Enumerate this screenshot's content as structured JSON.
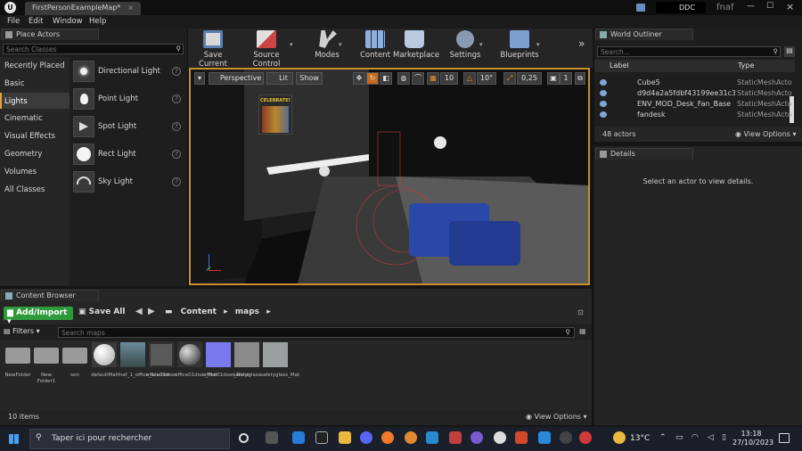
{
  "window": {
    "tab_title": "FirstPersonExampleMap*",
    "ddc_label": "DDC",
    "project_name": "fnaf"
  },
  "menu": [
    "File",
    "Edit",
    "Window",
    "Help"
  ],
  "place_actors": {
    "title": "Place Actors",
    "search_placeholder": "Search Classes",
    "categories": [
      "Recently Placed",
      "Basic",
      "Lights",
      "Cinematic",
      "Visual Effects",
      "Geometry",
      "Volumes",
      "All Classes"
    ],
    "selected_category": "Lights",
    "items": [
      "Directional Light",
      "Point Light",
      "Spot Light",
      "Rect Light",
      "Sky Light"
    ]
  },
  "toolbar": {
    "buttons": [
      "Save Current",
      "Source Control",
      "Modes",
      "Content",
      "Marketplace",
      "Settings",
      "Blueprints"
    ]
  },
  "viewport": {
    "perspective": "Perspective",
    "lit": "Lit",
    "show": "Show",
    "grid_snap": "10",
    "rotation_snap": "10°",
    "scale_snap": "0,25",
    "camera_speed": "1",
    "poster_text": "CELEBRATE!"
  },
  "world_outliner": {
    "title": "World Outliner",
    "search_placeholder": "Search...",
    "col_label": "Label",
    "col_type": "Type",
    "rows": [
      {
        "label": "Cube5",
        "type": "StaticMeshActor"
      },
      {
        "label": "d9d4a2a5fdbf43199ee31c3d0b",
        "type": "StaticMeshActor"
      },
      {
        "label": "ENV_MOD_Desk_Fan_Base",
        "type": "StaticMeshActor"
      },
      {
        "label": "fandesk",
        "type": "StaticMeshActor"
      }
    ],
    "actor_count": "48 actors",
    "view_options": "View Options"
  },
  "details": {
    "title": "Details",
    "empty_text": "Select an actor to view details."
  },
  "content_browser": {
    "title": "Content Browser",
    "add_import": "Add/Import",
    "save_all": "Save All",
    "path": [
      "Content",
      "maps"
    ],
    "filters": "Filters",
    "search_placeholder": "Search maps",
    "assets": [
      "NewFolder",
      "New Folder1",
      "son",
      "defaultMat",
      "fnaf_1_office_window",
      "office01door",
      "office01door_Mat",
      "office01door_Norm",
      "safetyglass",
      "safetyglass_Mat"
    ],
    "item_count": "10 items",
    "view_options": "View Options"
  },
  "taskbar": {
    "search_placeholder": "Taper ici pour rechercher",
    "weather": "13°C",
    "time": "13:18",
    "date": "27/10/2023"
  }
}
